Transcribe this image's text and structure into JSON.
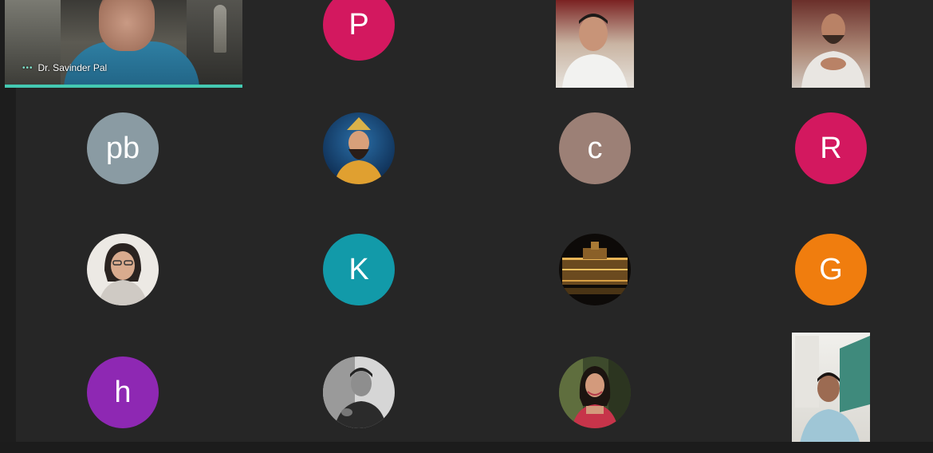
{
  "colors": {
    "background": "#262626",
    "speaking_highlight": "#44c9b2",
    "name_text": "#ffffff"
  },
  "speaker": {
    "name": "Dr. Savinder Pal",
    "indicator": "•••"
  },
  "participants": [
    {
      "id": "p",
      "initial": "P",
      "color": "#d3185f"
    },
    {
      "id": "pb",
      "initial": "pb",
      "color": "#8a9ba3"
    },
    {
      "id": "c",
      "initial": "c",
      "color": "#9c8076"
    },
    {
      "id": "r",
      "initial": "R",
      "color": "#d3185f"
    },
    {
      "id": "k",
      "initial": "K",
      "color": "#129aa9"
    },
    {
      "id": "g",
      "initial": "G",
      "color": "#f07d0e"
    },
    {
      "id": "h",
      "initial": "h",
      "color": "#8e28b3"
    }
  ]
}
